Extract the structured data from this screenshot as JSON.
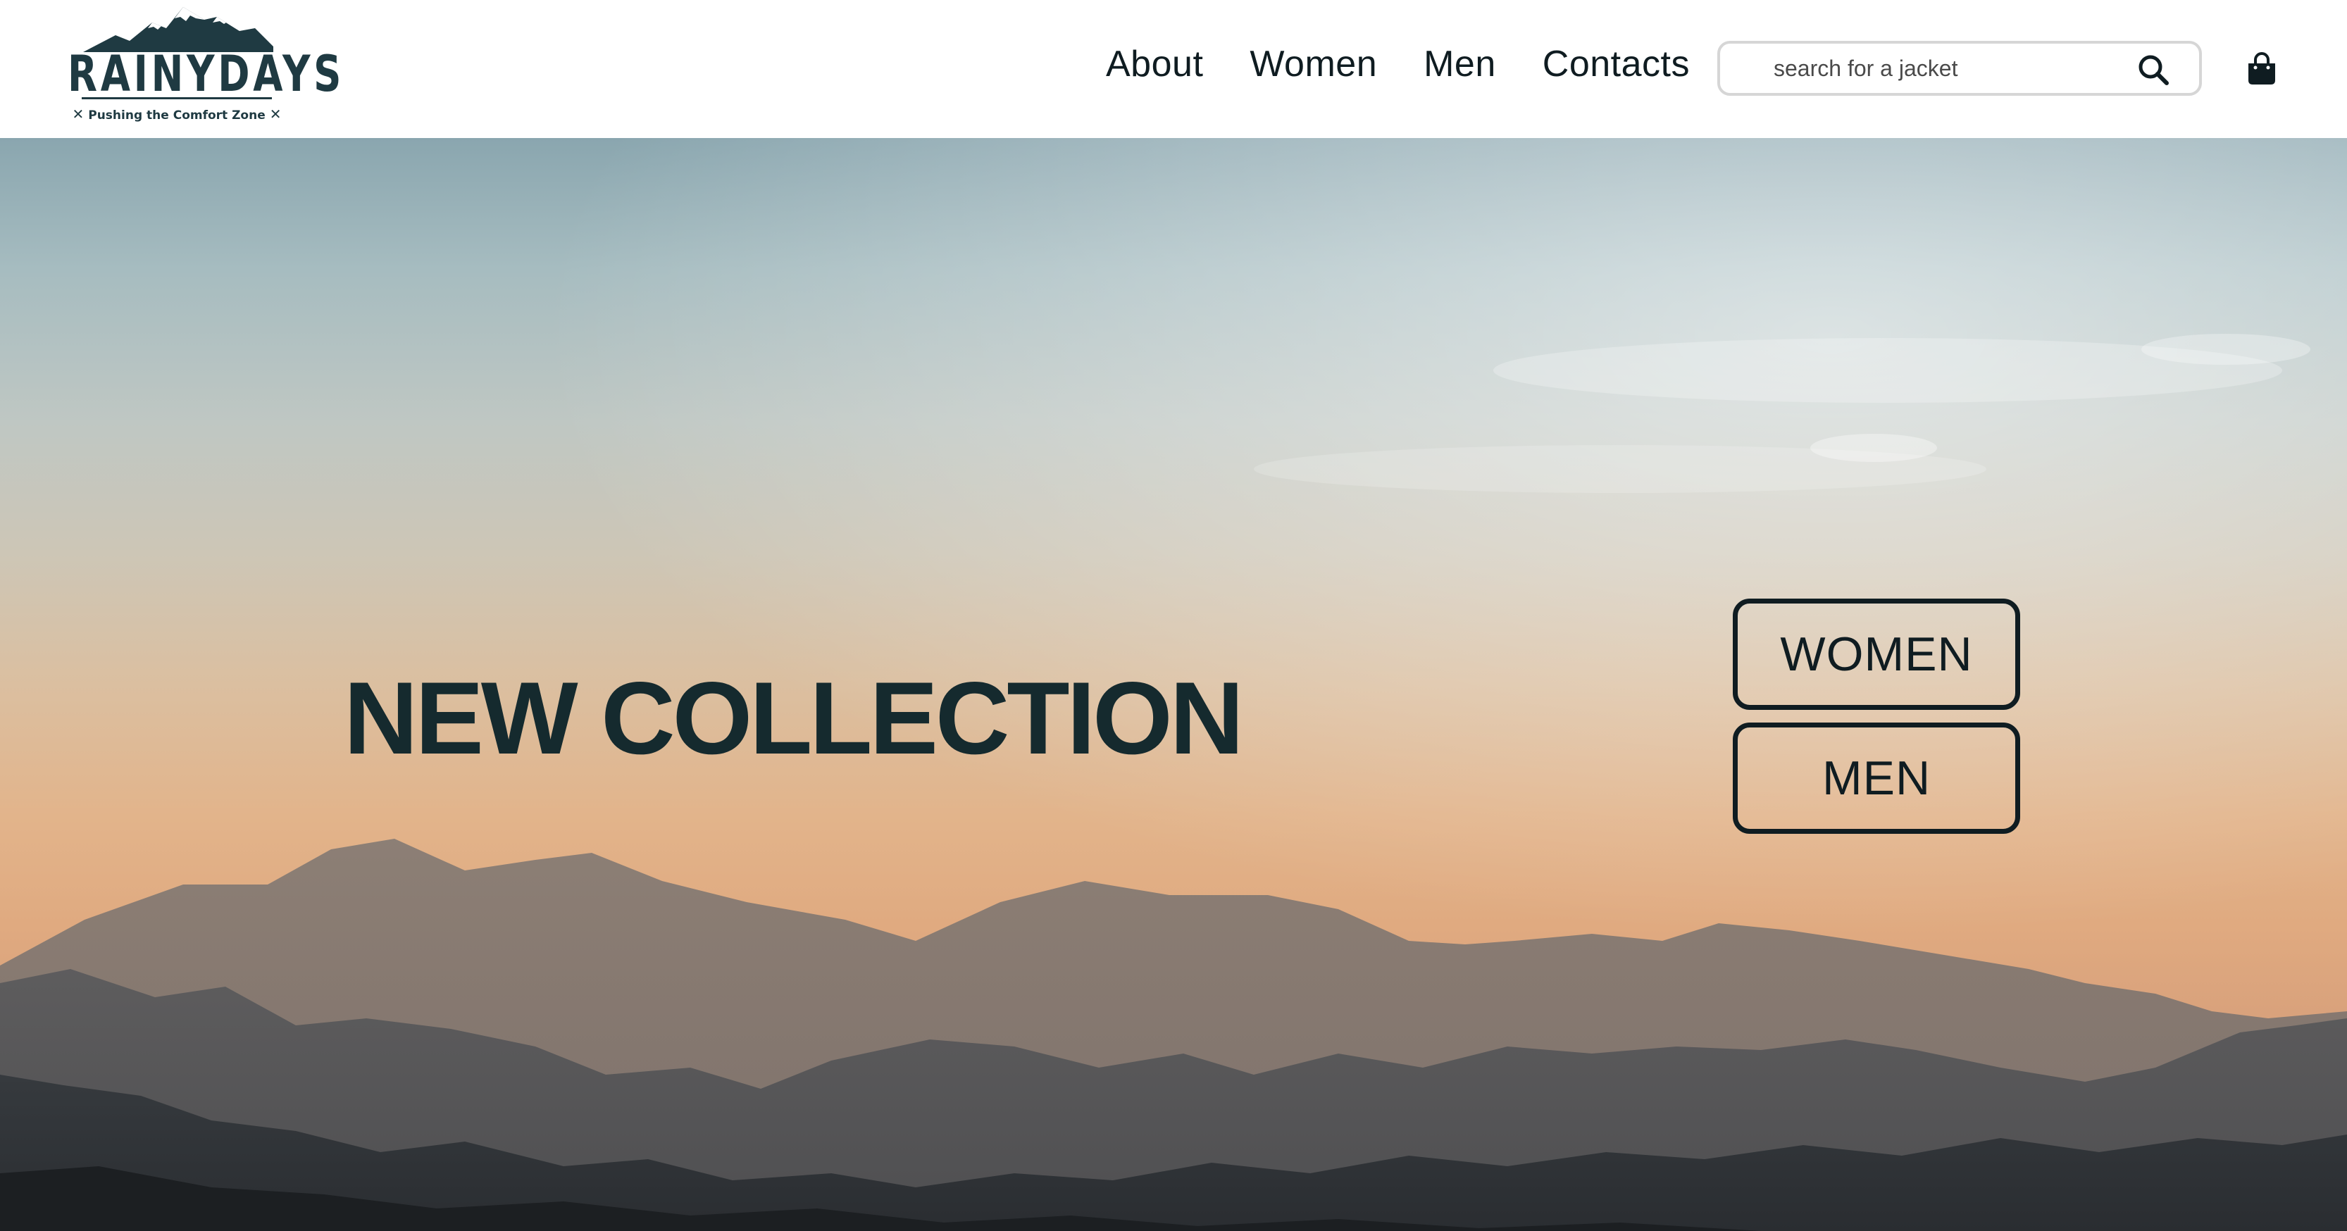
{
  "header": {
    "logo": {
      "wordmark": "RAINYDAYS",
      "tagline": "Pushing the Comfort Zone"
    },
    "nav": [
      {
        "label": "About"
      },
      {
        "label": "Women"
      },
      {
        "label": "Men"
      },
      {
        "label": "Contacts"
      }
    ],
    "search": {
      "placeholder": "search for a jacket",
      "value": "",
      "icon": "search-icon"
    },
    "cart_icon": "shopping-bag-icon"
  },
  "hero": {
    "title": "NEW COLLECTION",
    "buttons": {
      "women": "WOMEN",
      "men": "MEN"
    },
    "background": "sunset-mountains"
  },
  "colors": {
    "brand": "#1f3a42",
    "text_dark": "#0f1c21",
    "search_border": "#d6d6d6"
  }
}
